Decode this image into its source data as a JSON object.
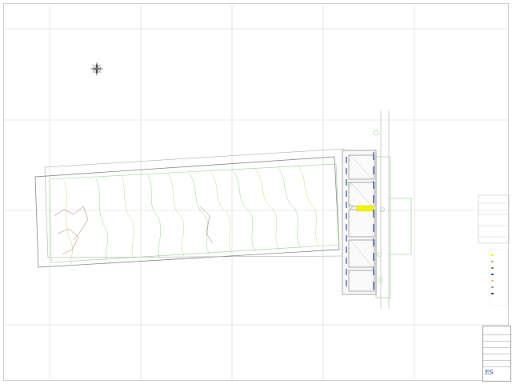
{
  "drawing": {
    "title_block": {
      "logo_text": "ES"
    },
    "colors": {
      "grid": "#d4d4d4",
      "contour_primary": "#8fd08a",
      "contour_secondary": "#d7c97a",
      "contour_brown": "#a07060",
      "boundary": "#6a6a6a",
      "building_blue": "#2244aa",
      "highlight_yellow": "#f3f000",
      "green_strip": "#7fcf7f"
    },
    "icons": [
      "north-arrow-icon",
      "tree-icon"
    ]
  }
}
